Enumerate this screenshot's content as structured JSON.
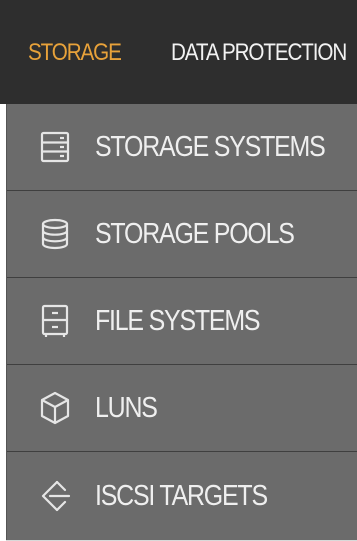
{
  "nav": {
    "tabs": [
      {
        "label": "STORAGE",
        "active": true
      },
      {
        "label": "DATA PROTECTION",
        "active": false
      }
    ]
  },
  "menu": {
    "items": [
      {
        "label": "STORAGE SYSTEMS",
        "icon": "server-icon"
      },
      {
        "label": "STORAGE POOLS",
        "icon": "database-icon"
      },
      {
        "label": "FILE SYSTEMS",
        "icon": "filing-cabinet-icon"
      },
      {
        "label": "LUNS",
        "icon": "cube-icon"
      },
      {
        "label": "ISCSI TARGETS",
        "icon": "target-arrow-icon"
      }
    ]
  },
  "colors": {
    "active_tab": "#e8a23a",
    "topbar_bg": "#2e2e2e",
    "menu_bg": "#6b6b6b",
    "menu_text": "#efefef"
  }
}
